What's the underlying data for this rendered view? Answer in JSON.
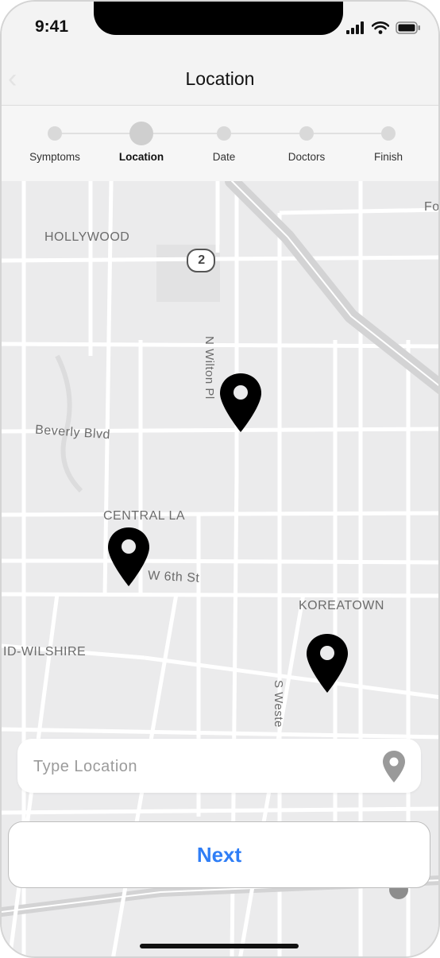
{
  "status_bar": {
    "time": "9:41"
  },
  "header": {
    "title": "Location"
  },
  "stepper": {
    "steps": [
      {
        "label": "Symptoms"
      },
      {
        "label": "Location"
      },
      {
        "label": "Date"
      },
      {
        "label": "Doctors"
      },
      {
        "label": "Finish"
      }
    ],
    "active_step": "Location"
  },
  "map": {
    "labels": {
      "hollywood": "HOLLYWOOD",
      "route_shield": "2",
      "n_wilton": "N Wilton Pl",
      "beverly": "Beverly Blvd",
      "central_la": "CENTRAL LA",
      "w_6th": "W 6th St",
      "koreatown": "KOREATOWN",
      "mid_wilshire": "ID-WILSHIRE",
      "s_western": "S Weste",
      "top_right_partial": "Fo"
    },
    "pins": 3
  },
  "search": {
    "placeholder": "Type Location",
    "value": ""
  },
  "next_button": {
    "label": "Next"
  },
  "colors": {
    "accent": "#2f7ef6",
    "pin": "#000000",
    "map_bg": "#ebebec"
  }
}
